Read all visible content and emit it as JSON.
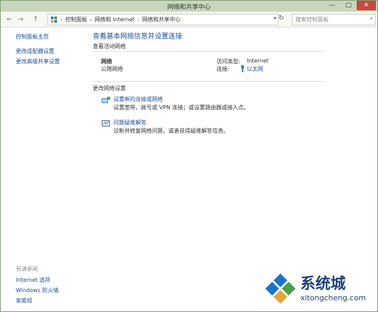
{
  "window": {
    "title": "网络和共享中心",
    "minimize": "—",
    "maximize": "□",
    "close": "✕"
  },
  "address": {
    "back": "←",
    "forward": "→",
    "up": "↑",
    "crumbs": [
      "控制面板",
      "网络和 Internet",
      "网络和共享中心"
    ],
    "search_placeholder": "搜索控制面板"
  },
  "sidebar": {
    "links": [
      "控制面板主页",
      "更改适配器设置",
      "更改高级共享设置"
    ],
    "see_also_title": "另请参阅",
    "see_also": [
      "Internet 选项",
      "Windows 防火墙",
      "家庭组"
    ]
  },
  "main": {
    "title": "查看基本网络信息并设置连接",
    "active_networks_label": "查看活动网络",
    "network_name": "网络",
    "network_type": "公用网络",
    "access_type_label": "访问类型:",
    "access_type_value": "Internet",
    "connections_label": "连接:",
    "connections_value": "以太网",
    "change_settings_label": "更改网络设置",
    "setup_link": "设置新的连接或网络",
    "setup_desc": "设置宽带、拨号或 VPN 连接；或设置路由器或接入点。",
    "troubleshoot_link": "问题疑难解答",
    "troubleshoot_desc": "诊断并修复网络问题，或者获得疑难解答信息。"
  },
  "watermark": {
    "brand": "系统城",
    "url": "xitongcheng.com"
  },
  "colors": {
    "link": "#1a4e97",
    "titlebar": "#c8d6bf",
    "close": "#c9473d"
  }
}
